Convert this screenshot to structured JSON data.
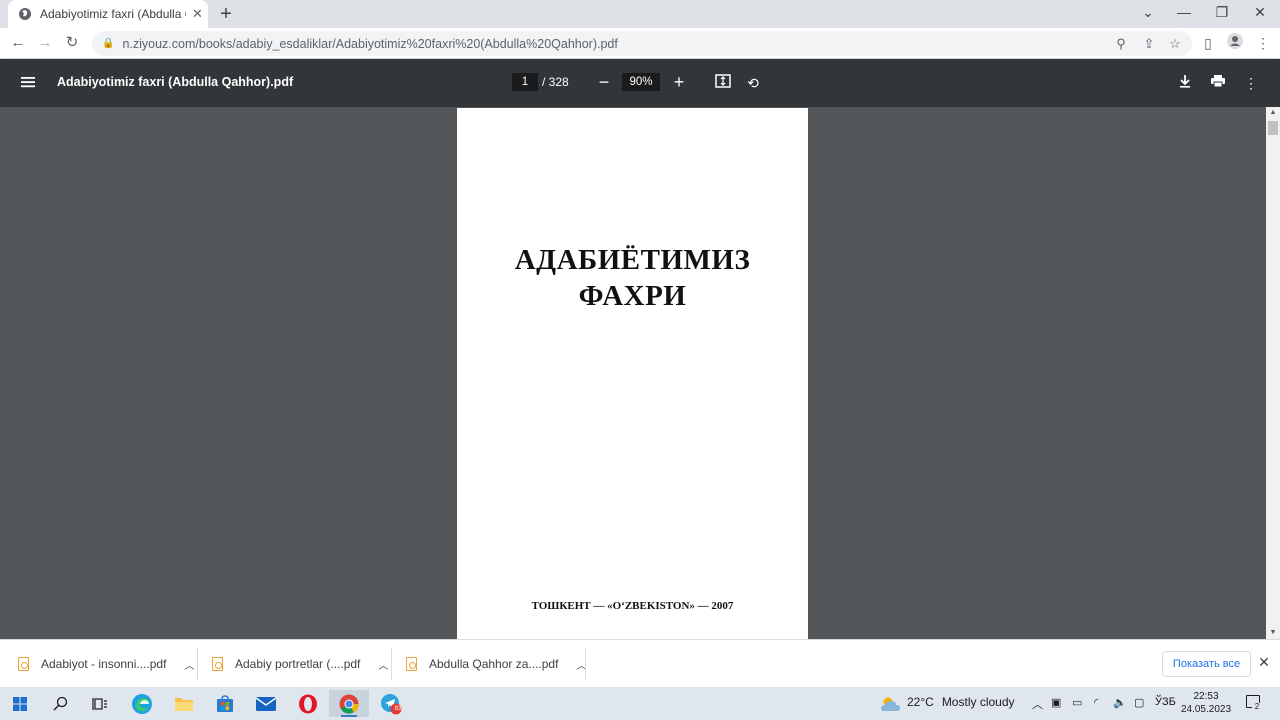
{
  "browser": {
    "tab_title": "Adabiyotimiz faxri (Abdulla Qahhor).pdf",
    "url": "n.ziyouz.com/books/adabiy_esdaliklar/Adabiyotimiz%20faxri%20(Abdulla%20Qahhor).pdf"
  },
  "pdf_toolbar": {
    "file_title": "Adabiyotimiz faxri (Abdulla Qahhor).pdf",
    "page_current": "1",
    "page_total": "/ 328",
    "zoom": "90%"
  },
  "document": {
    "title_line1": "АДАБИЁТИМИЗ",
    "title_line2": "ФАХРИ",
    "imprint": "ТОШКЕНТ — «O‘ZBEKISTON» — 2007"
  },
  "downloads": {
    "items": [
      {
        "name": "Adabiyot - insonni....pdf"
      },
      {
        "name": "Adabiy portretlar (....pdf"
      },
      {
        "name": "Abdulla Qahhor za....pdf"
      }
    ],
    "show_all_label": "Показать все"
  },
  "taskbar": {
    "weather_temp": "22°C",
    "weather_text": "Mostly cloudy",
    "language": "ЎЗБ",
    "time": "22:53",
    "date": "24.05.2023",
    "telegram_badge": "83",
    "notification_count": "2"
  },
  "colors": {
    "pdf_toolbar_bg": "#323639",
    "viewer_bg": "#525659",
    "accent": "#1a73e8"
  }
}
